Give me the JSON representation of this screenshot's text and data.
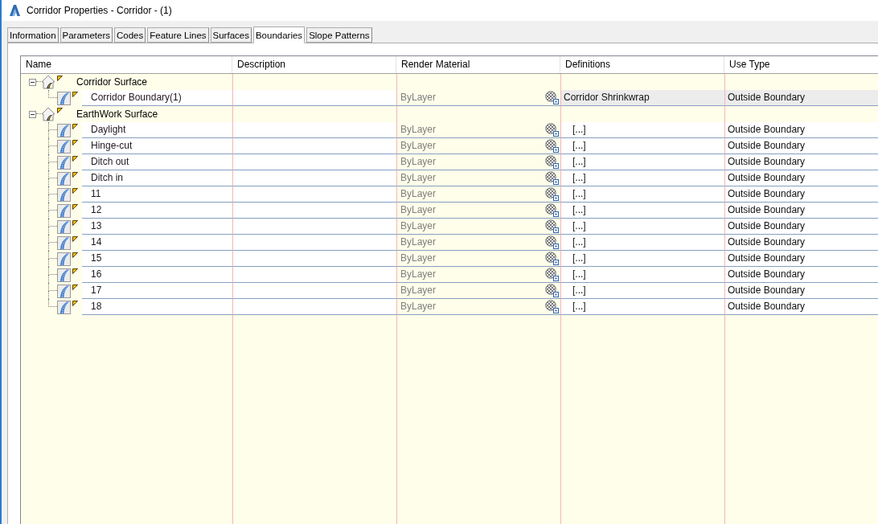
{
  "window": {
    "title": "Corridor Properties - Corridor - (1)"
  },
  "tabs": [
    {
      "label": "Information",
      "selected": false
    },
    {
      "label": "Parameters",
      "selected": false
    },
    {
      "label": "Codes",
      "selected": false
    },
    {
      "label": "Feature Lines",
      "selected": false
    },
    {
      "label": "Surfaces",
      "selected": false
    },
    {
      "label": "Boundaries",
      "selected": true
    },
    {
      "label": "Slope Patterns",
      "selected": false
    }
  ],
  "grid": {
    "columns": [
      "Name",
      "Description",
      "Render Material",
      "Definitions",
      "Use Type"
    ],
    "groups": [
      {
        "name": "Corridor Surface",
        "expanded": true,
        "children": [
          {
            "name": "Corridor Boundary(1)",
            "selected": true,
            "render_material": "ByLayer",
            "definition": {
              "kind": "value",
              "text": "Corridor Shrinkwrap"
            },
            "use_type": "Outside Boundary"
          }
        ]
      },
      {
        "name": "EarthWork Surface",
        "expanded": true,
        "children": [
          {
            "name": "Daylight",
            "selected": false,
            "render_material": "ByLayer",
            "definition": {
              "kind": "button",
              "text": "[...]"
            },
            "use_type": "Outside Boundary"
          },
          {
            "name": "Hinge-cut",
            "selected": false,
            "render_material": "ByLayer",
            "definition": {
              "kind": "button",
              "text": "[...]"
            },
            "use_type": "Outside Boundary"
          },
          {
            "name": "Ditch out",
            "selected": false,
            "render_material": "ByLayer",
            "definition": {
              "kind": "button",
              "text": "[...]"
            },
            "use_type": "Outside Boundary"
          },
          {
            "name": "Ditch in",
            "selected": false,
            "render_material": "ByLayer",
            "definition": {
              "kind": "button",
              "text": "[...]"
            },
            "use_type": "Outside Boundary"
          },
          {
            "name": "11",
            "selected": false,
            "render_material": "ByLayer",
            "definition": {
              "kind": "button",
              "text": "[...]"
            },
            "use_type": "Outside Boundary"
          },
          {
            "name": "12",
            "selected": false,
            "render_material": "ByLayer",
            "definition": {
              "kind": "button",
              "text": "[...]"
            },
            "use_type": "Outside Boundary"
          },
          {
            "name": "13",
            "selected": false,
            "render_material": "ByLayer",
            "definition": {
              "kind": "button",
              "text": "[...]"
            },
            "use_type": "Outside Boundary"
          },
          {
            "name": "14",
            "selected": false,
            "render_material": "ByLayer",
            "definition": {
              "kind": "button",
              "text": "[...]"
            },
            "use_type": "Outside Boundary"
          },
          {
            "name": "15",
            "selected": false,
            "render_material": "ByLayer",
            "definition": {
              "kind": "button",
              "text": "[...]"
            },
            "use_type": "Outside Boundary"
          },
          {
            "name": "16",
            "selected": false,
            "render_material": "ByLayer",
            "definition": {
              "kind": "button",
              "text": "[...]"
            },
            "use_type": "Outside Boundary"
          },
          {
            "name": "17",
            "selected": false,
            "render_material": "ByLayer",
            "definition": {
              "kind": "button",
              "text": "[...]"
            },
            "use_type": "Outside Boundary"
          },
          {
            "name": "18",
            "selected": false,
            "render_material": "ByLayer",
            "definition": {
              "kind": "button",
              "text": "[...]"
            },
            "use_type": "Outside Boundary"
          }
        ]
      }
    ]
  }
}
